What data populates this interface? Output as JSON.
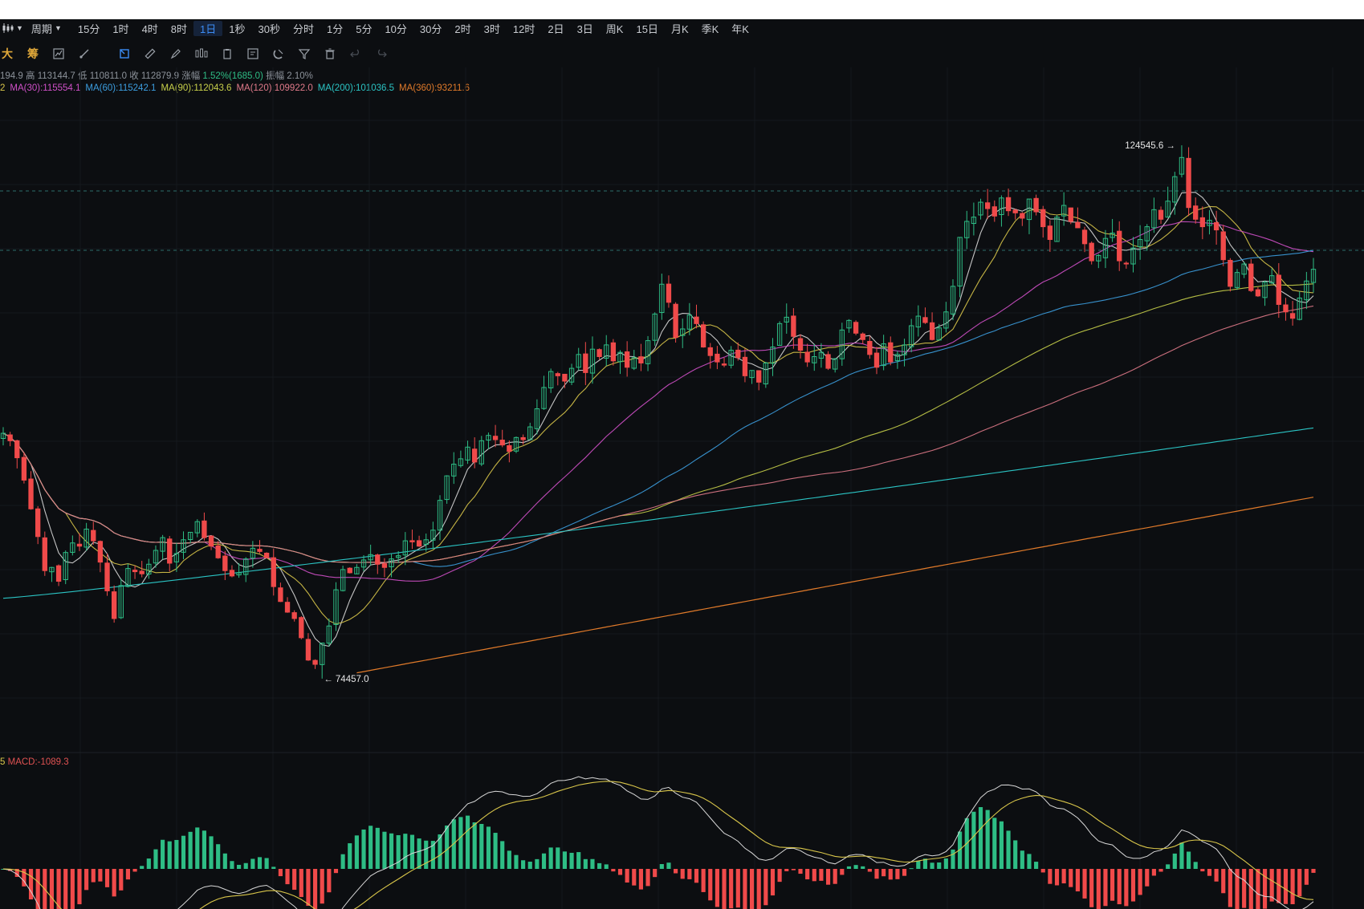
{
  "toolbar": {
    "chart_type_icon": "candlestick-icon",
    "period_label": "周期",
    "timeframes": [
      "15分",
      "1时",
      "4时",
      "8时",
      "1日",
      "1秒",
      "30秒",
      "分时",
      "1分",
      "5分",
      "10分",
      "30分",
      "2时",
      "3时",
      "12时",
      "2日",
      "3日",
      "周K",
      "15日",
      "月K",
      "季K",
      "年K"
    ],
    "active_timeframe": "1日"
  },
  "drawing_tools": {
    "text_tools": [
      "大",
      "筹"
    ],
    "icons": [
      "indicator-icon",
      "line-tool-icon",
      "select-icon",
      "ruler-icon",
      "pen-icon",
      "candles-icon",
      "clipboard-icon",
      "note-icon",
      "magnet-icon",
      "filter-icon",
      "trash-icon",
      "undo-icon",
      "redo-icon"
    ]
  },
  "ohlc_text": {
    "open": "194.9",
    "high_label": "高",
    "high": "113144.7",
    "low_label": "低",
    "low": "110811.0",
    "close_label": "收",
    "close": "112879.9",
    "change_label": "涨幅",
    "change": "1.52%(1685.0)",
    "amplitude_label": "振幅",
    "amplitude": "2.10%"
  },
  "ma_legend": [
    {
      "label": "2",
      "color": "#d9c64a"
    },
    {
      "label": "MA(30):115554.1",
      "color": "#d050c8"
    },
    {
      "label": "MA(60):115242.1",
      "color": "#3c9ee0"
    },
    {
      "label": "MA(90):112043.6",
      "color": "#c8d04a"
    },
    {
      "label": "MA(120):109922.0",
      "color": "#e07a8a"
    },
    {
      "label": "MA(200):101036.5",
      "color": "#2bc4c4"
    },
    {
      "label": "MA(360):93211.6",
      "color": "#e07a2a"
    }
  ],
  "macd_legend": {
    "prefix": "5",
    "label": "MACD:-1089.3",
    "color": "#e05252"
  },
  "annotations": {
    "high_marker": "124545.6 →",
    "low_marker": "← 74457.0"
  },
  "chart_data": {
    "type": "candlestick",
    "title": "",
    "y_range": [
      70000,
      129000
    ],
    "high_annotation": 124545.6,
    "low_annotation": 74457.0,
    "last_close": 112879.9,
    "colors": {
      "up": "#2ebd85",
      "down": "#f04a4a"
    },
    "candles_note": "daily OHLC sequence, left to right",
    "closes": [
      97500,
      96800,
      95200,
      93100,
      90400,
      87800,
      84600,
      84900,
      83600,
      86300,
      87200,
      86900,
      88500,
      87400,
      85400,
      82700,
      80100,
      83200,
      84800,
      84500,
      84300,
      85200,
      86500,
      87700,
      85300,
      86200,
      87500,
      88200,
      89200,
      87700,
      86900,
      85800,
      84600,
      84100,
      84400,
      85700,
      86700,
      86400,
      85800,
      83100,
      81700,
      80700,
      80100,
      78300,
      76200,
      75800,
      77800,
      79400,
      82800,
      84700,
      84400,
      84900,
      85600,
      86100,
      85200,
      84900,
      85700,
      86000,
      87400,
      87300,
      86900,
      87500,
      88400,
      91200,
      93500,
      94600,
      95100,
      96200,
      94800,
      96800,
      97300,
      96900,
      96400,
      95800,
      97100,
      96900,
      98100,
      99800,
      101800,
      103300,
      102900,
      102400,
      103600,
      104900,
      103200,
      105400,
      104700,
      105800,
      104300,
      105100,
      103700,
      104600,
      104100,
      106200,
      108700,
      111500,
      109800,
      106500,
      107300,
      108600,
      107800,
      105600,
      104800,
      104200,
      103900,
      105300,
      104600,
      102900,
      103400,
      102300,
      104100,
      105600,
      107800,
      108400,
      106600,
      105300,
      104200,
      104700,
      105100,
      103600,
      104500,
      107200,
      108100,
      106900,
      106300,
      104900,
      103700,
      105900,
      104200,
      104900,
      105800,
      107600,
      108500,
      107900,
      106300,
      107400,
      108900,
      111300,
      115900,
      117400,
      117800,
      119200,
      118600,
      117900,
      119600,
      118400,
      118200,
      117700,
      119500,
      118300,
      116900,
      115700,
      117800,
      118900,
      117400,
      116800,
      115300,
      113700,
      114200,
      115800,
      116300,
      113700,
      113400,
      114900,
      115700,
      116900,
      118500,
      117600,
      119300,
      121600,
      123400,
      118700,
      117600,
      116900,
      117500,
      116600,
      113800,
      111300,
      112600,
      113400,
      110900,
      110400,
      111700,
      112300,
      109600,
      108900,
      108300,
      110200,
      111800,
      112900
    ]
  },
  "macd": {
    "note": "histogram bars aligned with candles (positive green, negative red)",
    "colors": {
      "positive": "#2ebd85",
      "negative": "#f04a4a",
      "dif": "#d8d8d8",
      "dea": "#d9c64a"
    }
  }
}
